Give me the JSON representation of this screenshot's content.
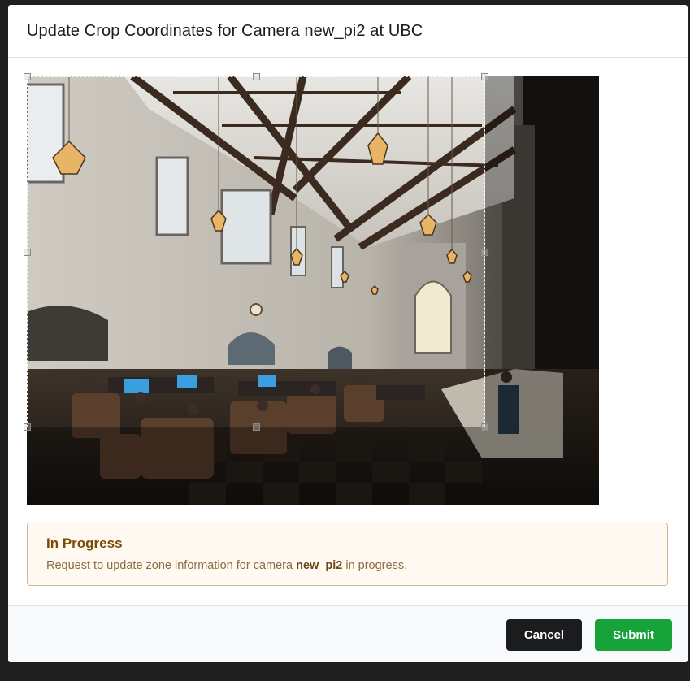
{
  "modal": {
    "title": "Update Crop Coordinates for Camera new_pi2 at UBC"
  },
  "camera_image": {
    "description_icon": "camera-snapshot"
  },
  "message": {
    "header": "In Progress",
    "text_before": "Request to update zone information for camera ",
    "camera_name": "new_pi2",
    "text_after": " in progress."
  },
  "footer": {
    "cancel_label": "Cancel",
    "submit_label": "Submit"
  },
  "colors": {
    "cancel_button": "#1b1c1d",
    "submit_button": "#16a33a",
    "message_background": "#fff9f1",
    "message_header": "#794b02"
  }
}
